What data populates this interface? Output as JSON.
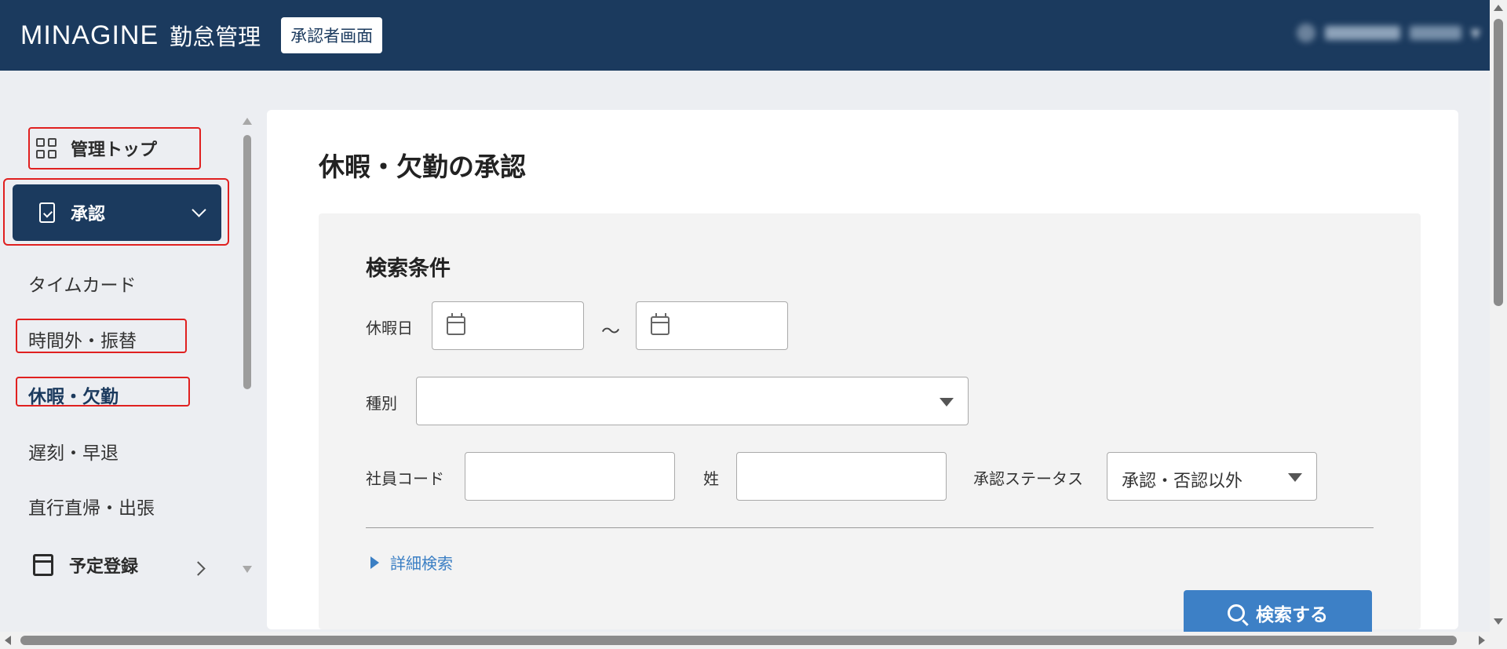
{
  "header": {
    "logo": "MINAGINE",
    "app_name": "勤怠管理",
    "mode_badge": "承認者画面"
  },
  "sidebar": {
    "top_item": "管理トップ",
    "approve_item": "承認",
    "sub_items": {
      "timecard": "タイムカード",
      "overtime": "時間外・振替",
      "leave": "休暇・欠勤",
      "late": "遅刻・早退",
      "direct": "直行直帰・出張"
    },
    "schedule_item": "予定登録"
  },
  "main": {
    "title": "休暇・欠勤の承認",
    "search": {
      "title": "検索条件",
      "leave_date_label": "休暇日",
      "range_separator": "～",
      "type_label": "種別",
      "type_value": "",
      "employee_code_label": "社員コード",
      "employee_code_value": "",
      "surname_label": "姓",
      "surname_value": "",
      "status_label": "承認ステータス",
      "status_value": "承認・否認以外",
      "detail_link": "詳細検索",
      "search_button": "検索する"
    }
  },
  "colors": {
    "header_bg": "#1b3a5e",
    "accent_blue": "#3d80c6",
    "highlight_red": "#e02020"
  }
}
